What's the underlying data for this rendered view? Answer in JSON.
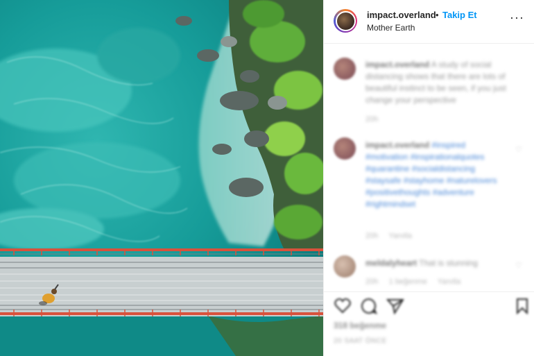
{
  "post": {
    "username": "impact.overland",
    "dot": "•",
    "follow_label": "Takip Et",
    "location": "Mother Earth",
    "more_label": "···"
  },
  "comments": [
    {
      "author": "impact.overland",
      "text": "A study of social distancing shows that there are lots of beautiful instinct to be seen, if you just change your perspective",
      "time": "20h",
      "reply": ""
    },
    {
      "author": "impact.overland",
      "text": "#inspired #motivation #inspirationalquotes #quarantine #socialdistancing #staysafe #stayhome #naturelovers #positivethoughts #adventure #rightmindset",
      "time": "20h",
      "reply": "Yanıtla"
    },
    {
      "author": "meldalyheart",
      "text": "That is stunning",
      "time": "20h",
      "likes_label": "1 beğenme",
      "reply": "Yanıtla"
    }
  ],
  "footer": {
    "likes": "318 beğenme",
    "date": "20 SAAT ÖNCE"
  },
  "colors": {
    "accent": "#0095f6",
    "text": "#262626"
  }
}
